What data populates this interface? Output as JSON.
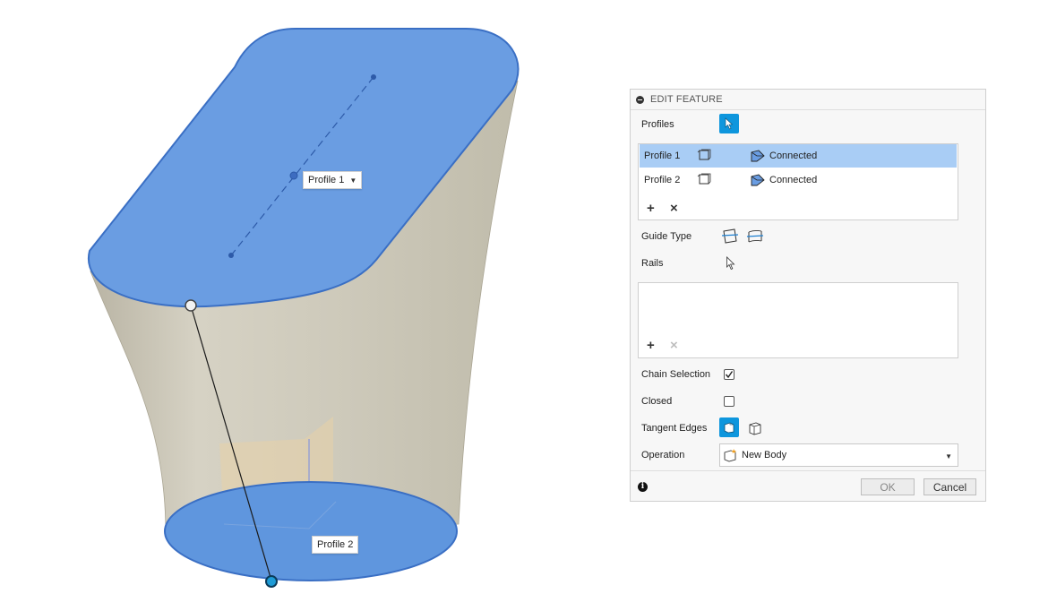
{
  "viewport": {
    "profile1_label": "Profile 1",
    "profile1_dropdown": "▼",
    "profile2_label": "Profile 2",
    "colors": {
      "profile_fill": "#6a9de2",
      "profile_edge": "#3a6fc4",
      "surface": "#cfcbbd"
    }
  },
  "panel": {
    "title": "EDIT FEATURE",
    "profiles_label": "Profiles",
    "profile_rows": [
      {
        "name": "Profile 1",
        "status": "Connected"
      },
      {
        "name": "Profile 2",
        "status": "Connected"
      }
    ],
    "add_symbol": "+",
    "remove_symbol": "×",
    "guide_type_label": "Guide Type",
    "rails_label": "Rails",
    "chain_selection_label": "Chain Selection",
    "chain_selection_checked": true,
    "closed_label": "Closed",
    "closed_checked": false,
    "tangent_edges_label": "Tangent Edges",
    "operation_label": "Operation",
    "operation_value": "New Body",
    "info_symbol": "i",
    "ok_label": "OK",
    "cancel_label": "Cancel",
    "colors": {
      "accent": "#0e96dd",
      "selected_row": "#a9cdf5"
    }
  }
}
